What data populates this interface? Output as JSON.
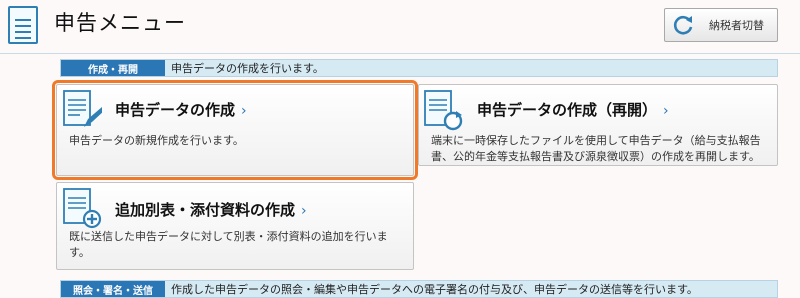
{
  "header": {
    "title": "申告メニュー",
    "switch_button": "納税者切替"
  },
  "sections": [
    {
      "tag": "作成・再開",
      "description": "申告データの作成を行います。",
      "cards": [
        {
          "title": "申告データの作成",
          "chevron": "›",
          "description": "申告データの新規作成を行います。",
          "icon": "document-pen-icon",
          "selected": true
        },
        {
          "title": "申告データの作成（再開）",
          "chevron": "›",
          "description_lines": [
            "端末に一時保存したファイルを使用して申告データ（給与支払報告",
            "書、公的年金等支払報告書及び源泉徴収票）の作成を再開します。"
          ],
          "icon": "document-refresh-icon"
        },
        {
          "title": "追加別表・添付資料の作成",
          "chevron": "›",
          "description_lines": [
            "既に送信した申告データに対して別表・添付資料の追加を行いま",
            "す。"
          ],
          "icon": "document-add-icon"
        }
      ]
    },
    {
      "tag": "照会・署名・送信",
      "description": "作成した申告データの照会・編集や申告データへの電子署名の付与及び、申告データの送信等を行います。"
    }
  ],
  "colors": {
    "accent": "#2b77b5",
    "selected_outline": "#ee7a2a"
  }
}
